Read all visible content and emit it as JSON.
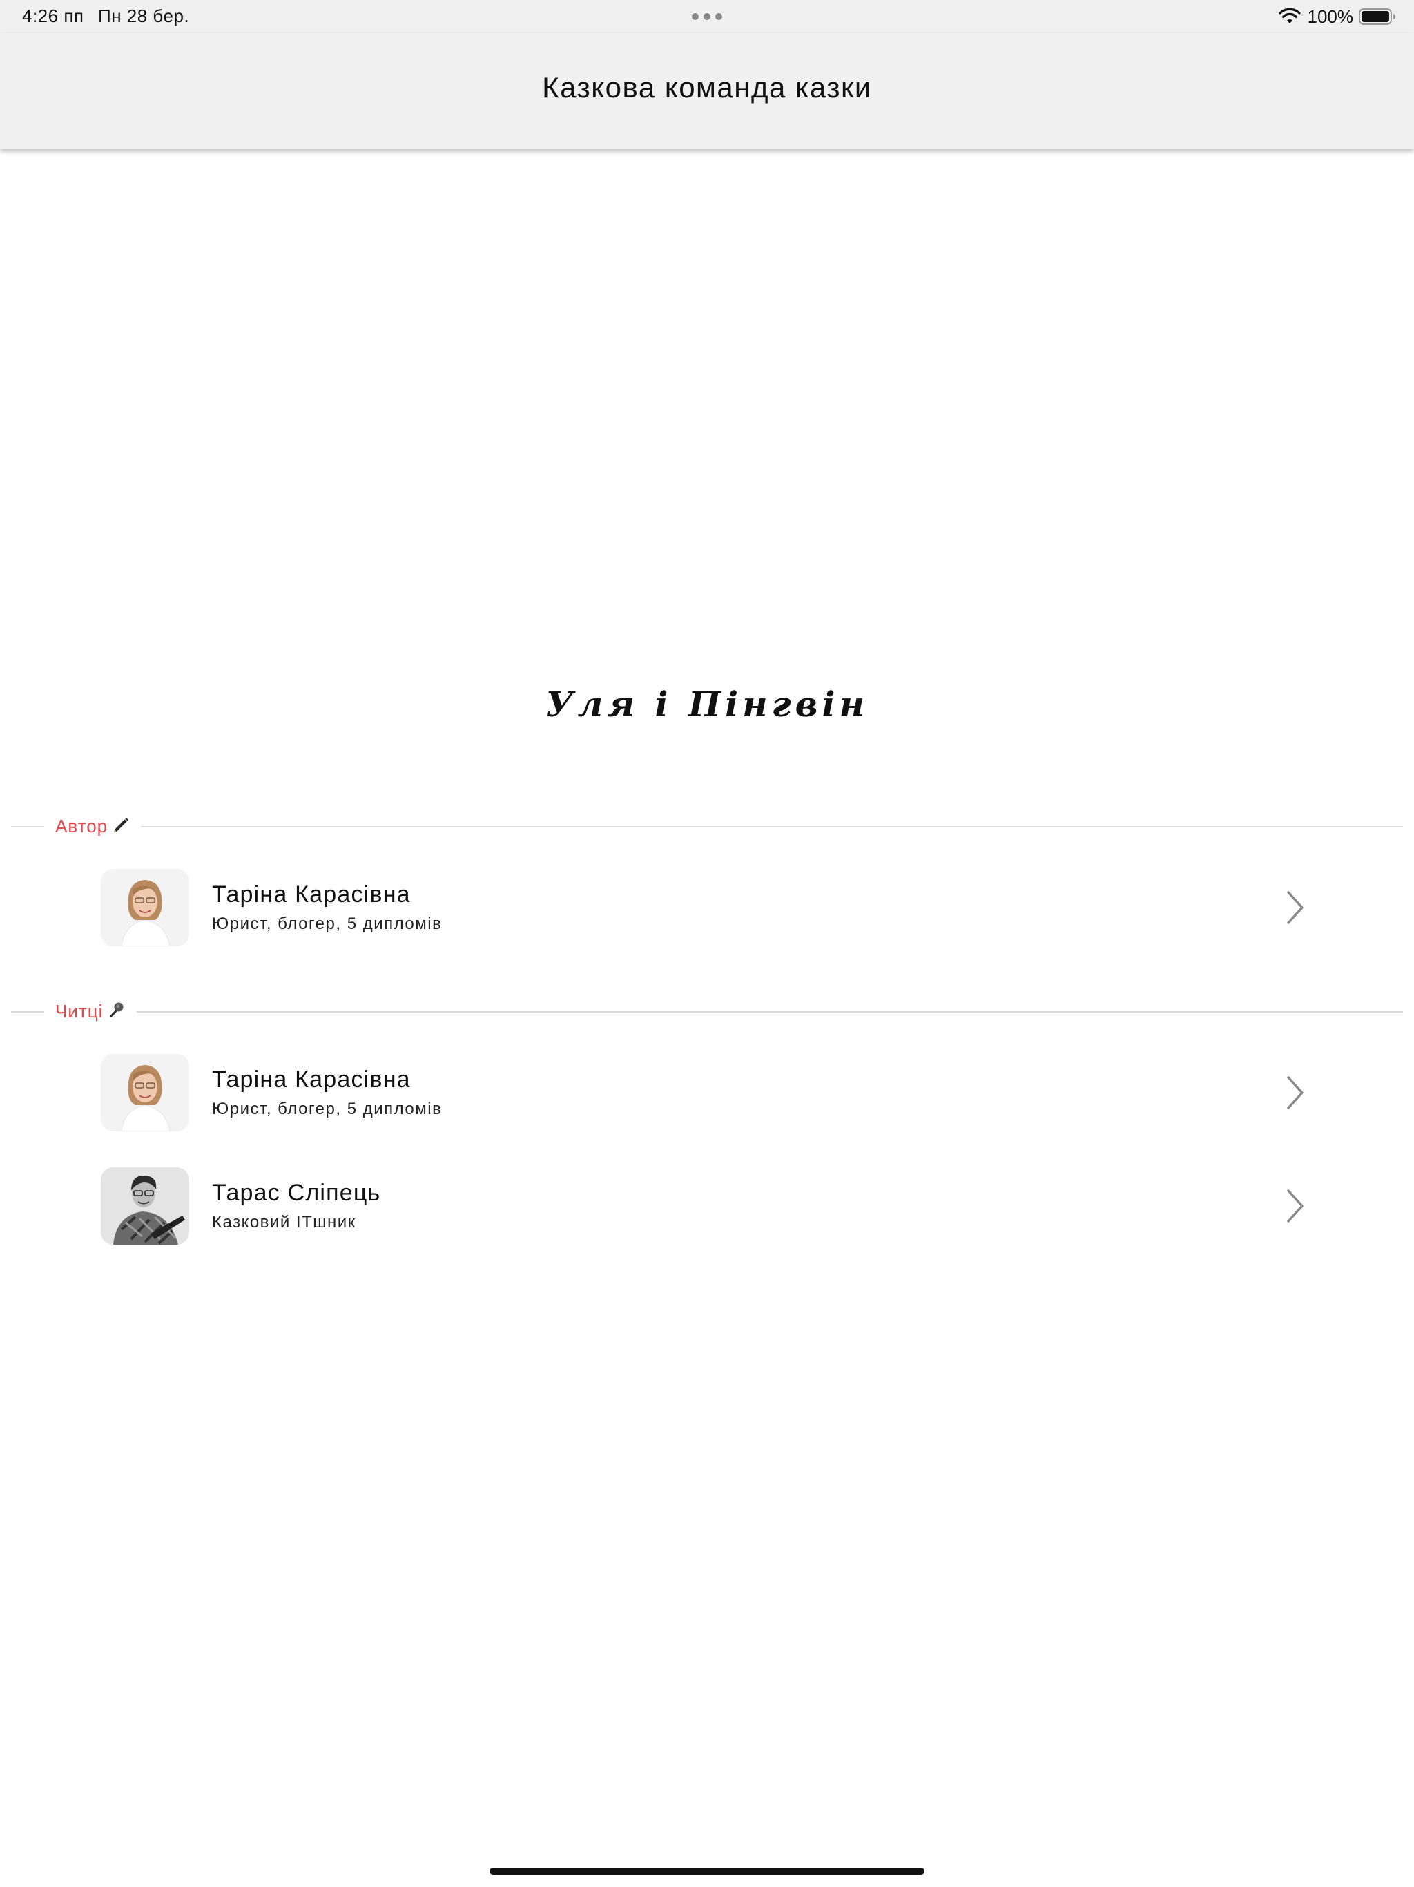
{
  "status_bar": {
    "time": "4:26 пп",
    "date": "Пн 28 бер.",
    "battery": "100%"
  },
  "nav": {
    "title": "Казкова команда казки"
  },
  "story": {
    "title": "Уля і Пінгвін"
  },
  "sections": [
    {
      "label": "Автор",
      "icon": "pen-icon",
      "people": [
        {
          "name": "Таріна Карасівна",
          "description": "Юрист, блогер, 5 дипломів",
          "avatar": "woman-photo-icon"
        }
      ]
    },
    {
      "label": "Читці",
      "icon": "microphone-icon",
      "people": [
        {
          "name": "Таріна Карасівна",
          "description": "Юрист, блогер, 5 дипломів",
          "avatar": "woman-photo-icon"
        },
        {
          "name": "Тарас Сліпець",
          "description": "Казковий ІТшник",
          "avatar": "man-photo-icon"
        }
      ]
    }
  ],
  "colors": {
    "accent": "#e2474b",
    "bar_background": "#f0f0f0"
  }
}
